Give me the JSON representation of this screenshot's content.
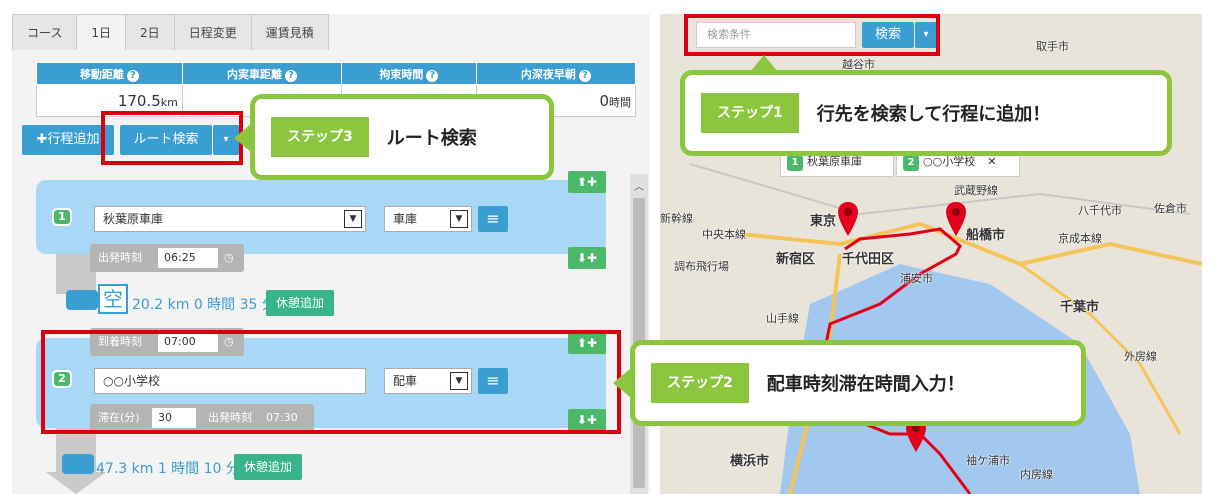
{
  "tabs": [
    "コース",
    "1日",
    "2日",
    "日程変更",
    "運賃見積"
  ],
  "stats": {
    "headers": [
      "移動距離",
      "内実車距離",
      "拘束時間",
      "内深夜早朝"
    ],
    "distance": "170.5",
    "distance_unit": "km",
    "late_night": "0",
    "late_night_unit": "時間",
    "help_icon": "?"
  },
  "toolbar": {
    "add_stop": "✚行程追加",
    "route_search": "ルート検索"
  },
  "stop1": {
    "number": "1",
    "place": "秋葉原車庫",
    "type": "車庫",
    "depart_label": "出発時刻",
    "depart_time": "06:25"
  },
  "leg1": {
    "empty_label": "空",
    "text": "20.2 km 0 時間 35 分",
    "rest_button": "休憩追加"
  },
  "stop2": {
    "number": "2",
    "arrive_label": "到着時刻",
    "arrive_time": "07:00",
    "place": "○○小学校",
    "type": "配車",
    "stay_label": "滞在(分)",
    "stay_minutes": "30",
    "depart_label": "出発時刻",
    "depart_time": "07:30"
  },
  "leg2": {
    "text": "47.3 km 1 時間 10 分",
    "rest_button": "休憩追加"
  },
  "buttons": {
    "up_add": "⬆✚",
    "down_add": "⬇✚",
    "menu": "≡",
    "caret": "▾"
  },
  "callouts": {
    "step1": {
      "tag": "ステップ1",
      "text": "行先を検索して行程に追加！"
    },
    "step2": {
      "tag": "ステップ2",
      "text": "配車時刻滞在時間入力！"
    },
    "step3": {
      "tag": "ステップ3",
      "text": "ルート検索"
    }
  },
  "map": {
    "search_placeholder": "検索条件",
    "search_button": "検索",
    "info1": "秋葉原車庫",
    "info2": "○○小学校",
    "labels": {
      "tokyo": "東京",
      "shinjuku": "新宿区",
      "chiyoda": "千代田区",
      "funabashi": "船橋市",
      "chiba": "千葉市",
      "yokohama": "横浜市",
      "urayasu": "浦安市",
      "yachiyo": "八千代市",
      "sakura": "佐倉市",
      "toride": "取手市",
      "koshigaya": "越谷市",
      "sodegaura": "袖ケ浦市",
      "chuo_line": "中央本線",
      "chofu_airport": "調布飛行場",
      "shinkansen": "新幹線",
      "musashino_line": "武蔵野線",
      "keisei_line": "京成本線",
      "sotobo_line": "外房線",
      "yamanote_line": "山手線",
      "uchibo_line": "内房線"
    }
  },
  "colors": {
    "accent": "#3a9ed3",
    "callout_green": "#8cc63f",
    "highlight_red": "#d9000f",
    "card_blue": "#a9d8f6",
    "route_red": "#e3001b"
  }
}
